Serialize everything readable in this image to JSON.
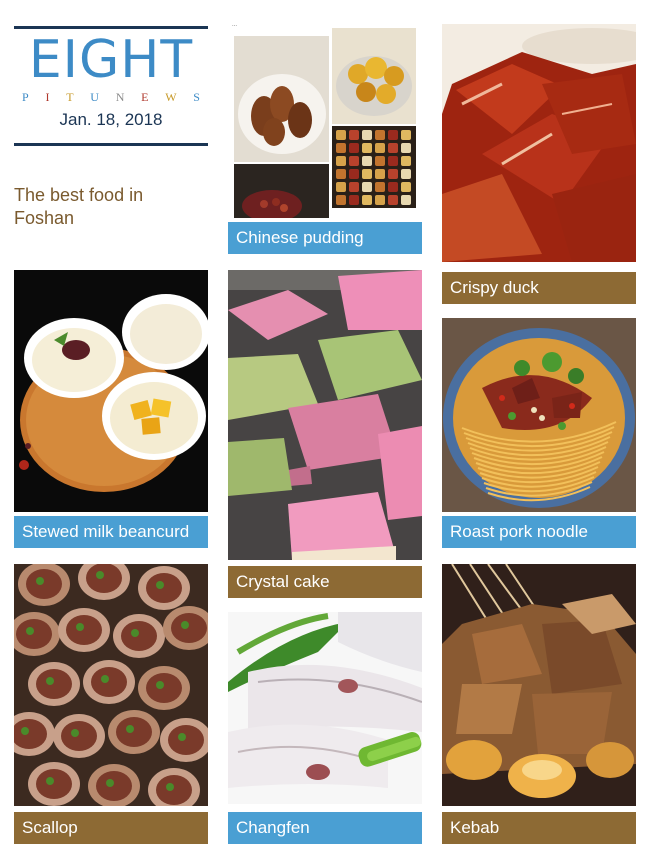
{
  "header": {
    "brand": "EIGHT",
    "subtitle_letters": [
      "P",
      "I",
      "T",
      "U",
      "N",
      "E",
      "W",
      "S"
    ],
    "subtitle_colors": [
      "#3d8bc6",
      "#b0392e",
      "#c79a2a",
      "#3d8bc6",
      "#8c8c8c",
      "#b0392e",
      "#c79a2a",
      "#3d8bc6"
    ],
    "date": "Jan. 18, 2018",
    "tagline": "The best food in Foshan"
  },
  "colors": {
    "accent_blue": "#4a9fd3",
    "accent_brown": "#8d6a34",
    "rule": "#1b3554"
  },
  "items": [
    {
      "caption": "Chinese pudding",
      "style": "blue"
    },
    {
      "caption": "Crispy duck",
      "style": "brown"
    },
    {
      "caption": "Stewed milk beancurd",
      "style": "blue"
    },
    {
      "caption": "Crystal cake",
      "style": "brown"
    },
    {
      "caption": "Roast pork noodle",
      "style": "blue"
    },
    {
      "caption": "Scallop",
      "style": "brown"
    },
    {
      "caption": "Changfen",
      "style": "blue"
    },
    {
      "caption": "Kebab",
      "style": "brown"
    }
  ]
}
